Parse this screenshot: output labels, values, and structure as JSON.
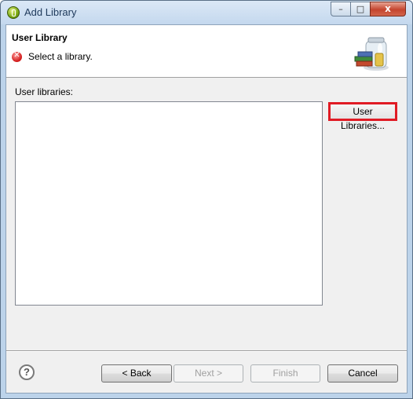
{
  "window": {
    "title": "Add Library",
    "icon": "eclipse-icon",
    "controls": {
      "minimize": "–",
      "maximize": "□",
      "close": "x"
    }
  },
  "header": {
    "title": "User Library",
    "message": "Select a library.",
    "status_icon": "error-icon",
    "status_glyph": "✕",
    "banner_icon": "library-jar-icon"
  },
  "content": {
    "list_label": "User libraries:",
    "items": [],
    "user_libraries_button": "User Libraries..."
  },
  "footer": {
    "help_glyph": "?",
    "back": "< Back",
    "next": "Next >",
    "finish": "Finish",
    "cancel": "Cancel"
  },
  "colors": {
    "highlight": "#e01b24",
    "error": "#d21e1e",
    "dialog_bg": "#f0f0f0"
  }
}
